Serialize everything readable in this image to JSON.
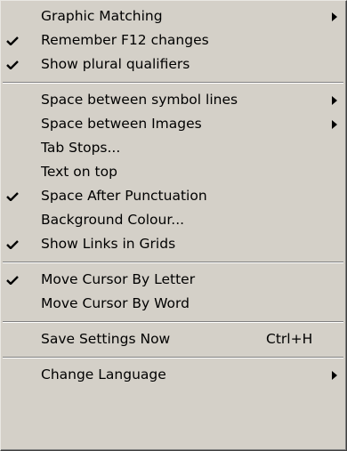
{
  "menu": {
    "items": [
      {
        "type": "item",
        "label": "Graphic Matching",
        "checked": false,
        "submenu": true,
        "shortcut": ""
      },
      {
        "type": "item",
        "label": "Remember F12 changes",
        "checked": true,
        "submenu": false,
        "shortcut": ""
      },
      {
        "type": "item",
        "label": "Show plural qualifiers",
        "checked": true,
        "submenu": false,
        "shortcut": ""
      },
      {
        "type": "separator"
      },
      {
        "type": "item",
        "label": "Space between symbol lines",
        "checked": false,
        "submenu": true,
        "shortcut": ""
      },
      {
        "type": "item",
        "label": "Space between Images",
        "checked": false,
        "submenu": true,
        "shortcut": ""
      },
      {
        "type": "item",
        "label": "Tab Stops...",
        "checked": false,
        "submenu": false,
        "shortcut": ""
      },
      {
        "type": "item",
        "label": "Text on top",
        "checked": false,
        "submenu": false,
        "shortcut": ""
      },
      {
        "type": "item",
        "label": "Space After Punctuation",
        "checked": true,
        "submenu": false,
        "shortcut": ""
      },
      {
        "type": "item",
        "label": "Background Colour...",
        "checked": false,
        "submenu": false,
        "shortcut": ""
      },
      {
        "type": "item",
        "label": "Show Links in Grids",
        "checked": true,
        "submenu": false,
        "shortcut": ""
      },
      {
        "type": "separator"
      },
      {
        "type": "item",
        "label": "Move Cursor By Letter",
        "checked": true,
        "submenu": false,
        "shortcut": ""
      },
      {
        "type": "item",
        "label": "Move Cursor By Word",
        "checked": false,
        "submenu": false,
        "shortcut": ""
      },
      {
        "type": "separator"
      },
      {
        "type": "item",
        "label": "Save Settings Now",
        "checked": false,
        "submenu": false,
        "shortcut": "Ctrl+H"
      },
      {
        "type": "separator"
      },
      {
        "type": "item",
        "label": "Change Language",
        "checked": false,
        "submenu": true,
        "shortcut": ""
      }
    ]
  },
  "icons": {
    "check": "checkmark-icon",
    "submenu": "submenu-arrow-icon"
  },
  "colors": {
    "menu_background": "#d4d0c8",
    "text": "#000000",
    "separator_shadow": "#808080",
    "separator_highlight": "#ffffff"
  }
}
